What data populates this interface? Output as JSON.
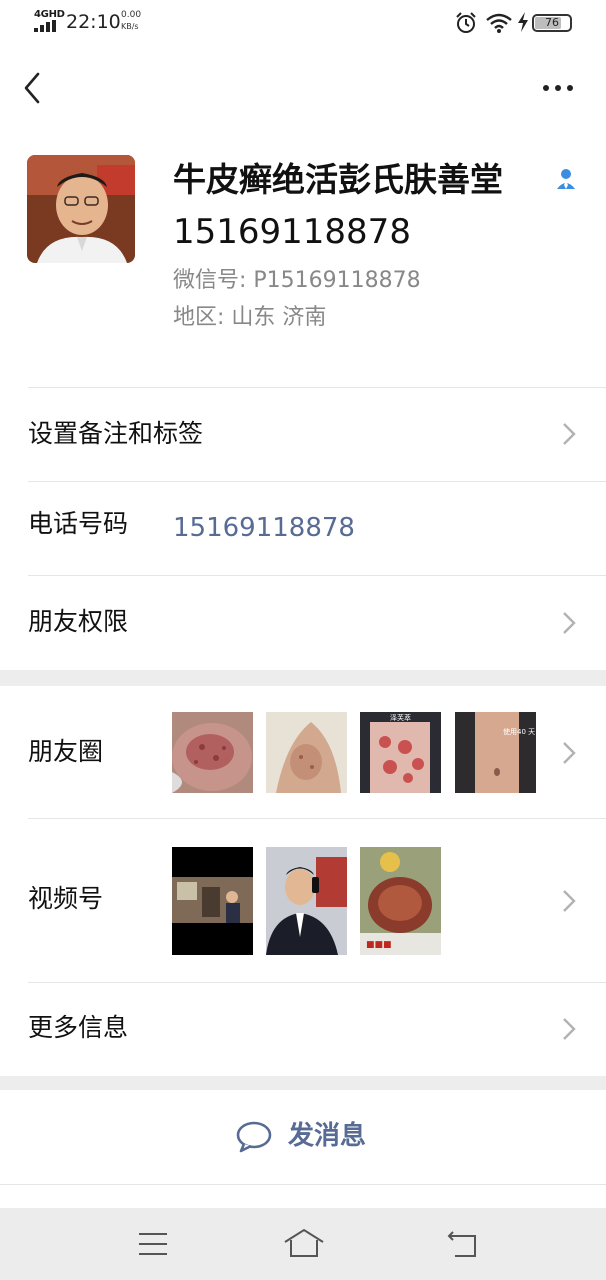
{
  "status_bar": {
    "network": "4GHD",
    "time": "22:10",
    "speed_value": "0.00",
    "speed_unit": "KB/s",
    "battery": "76"
  },
  "profile": {
    "name": "牛皮癣绝活彭氏肤善堂",
    "phone": "15169118878",
    "wechat_id": "微信号: P15169118878",
    "region": "地区: 山东  济南"
  },
  "rows": {
    "remark_tags": "设置备注和标签",
    "phone_label": "电话号码",
    "phone_value": "15169118878",
    "friend_permissions": "朋友权限",
    "moments": "朋友圈",
    "channels": "视频号",
    "more_info": "更多信息"
  },
  "actions": {
    "send_message": "发消息"
  },
  "thumb_overlay_text": {
    "moment_3": "泽芙萃",
    "moment_4": "使用40 天"
  },
  "colors": {
    "link": "#576b95",
    "background": "#ffffff",
    "separator": "#ededed",
    "nav_bar": "#ececec"
  }
}
